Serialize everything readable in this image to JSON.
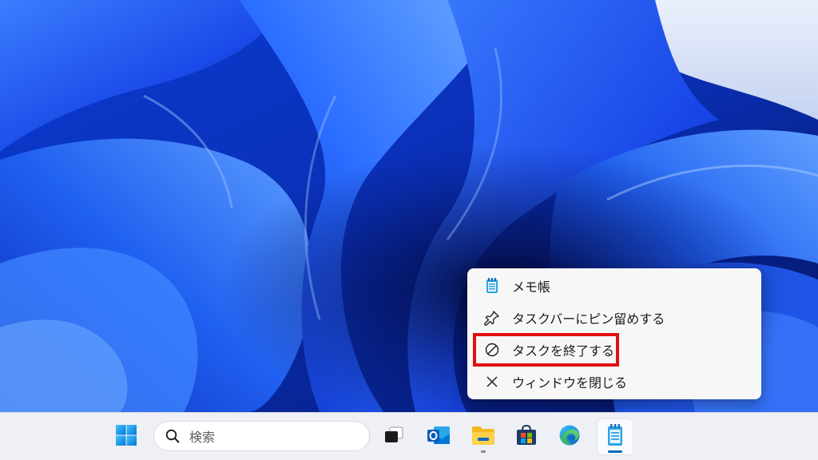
{
  "context_menu": {
    "items": [
      {
        "label": "メモ帳",
        "icon": "notepad-icon"
      },
      {
        "label": "タスクバーにピン留めする",
        "icon": "pin-icon"
      },
      {
        "label": "タスクを終了する",
        "icon": "prohibited-icon",
        "highlighted": true
      },
      {
        "label": "ウィンドウを閉じる",
        "icon": "close-icon"
      }
    ]
  },
  "taskbar": {
    "search_placeholder": "検索",
    "apps": [
      {
        "name": "start",
        "icon": "windows-start-icon"
      },
      {
        "name": "task-view",
        "icon": "task-view-icon"
      },
      {
        "name": "outlook",
        "icon": "outlook-icon"
      },
      {
        "name": "file-explorer",
        "icon": "file-explorer-icon",
        "running": true
      },
      {
        "name": "microsoft-store",
        "icon": "store-icon"
      },
      {
        "name": "edge",
        "icon": "edge-icon"
      },
      {
        "name": "notepad",
        "icon": "notepad-icon",
        "running": true,
        "active": true
      }
    ]
  },
  "colors": {
    "highlight_border": "#e10f0f",
    "accent_blue": "#0067c0",
    "wallpaper_blue": "#1a4fe0"
  }
}
